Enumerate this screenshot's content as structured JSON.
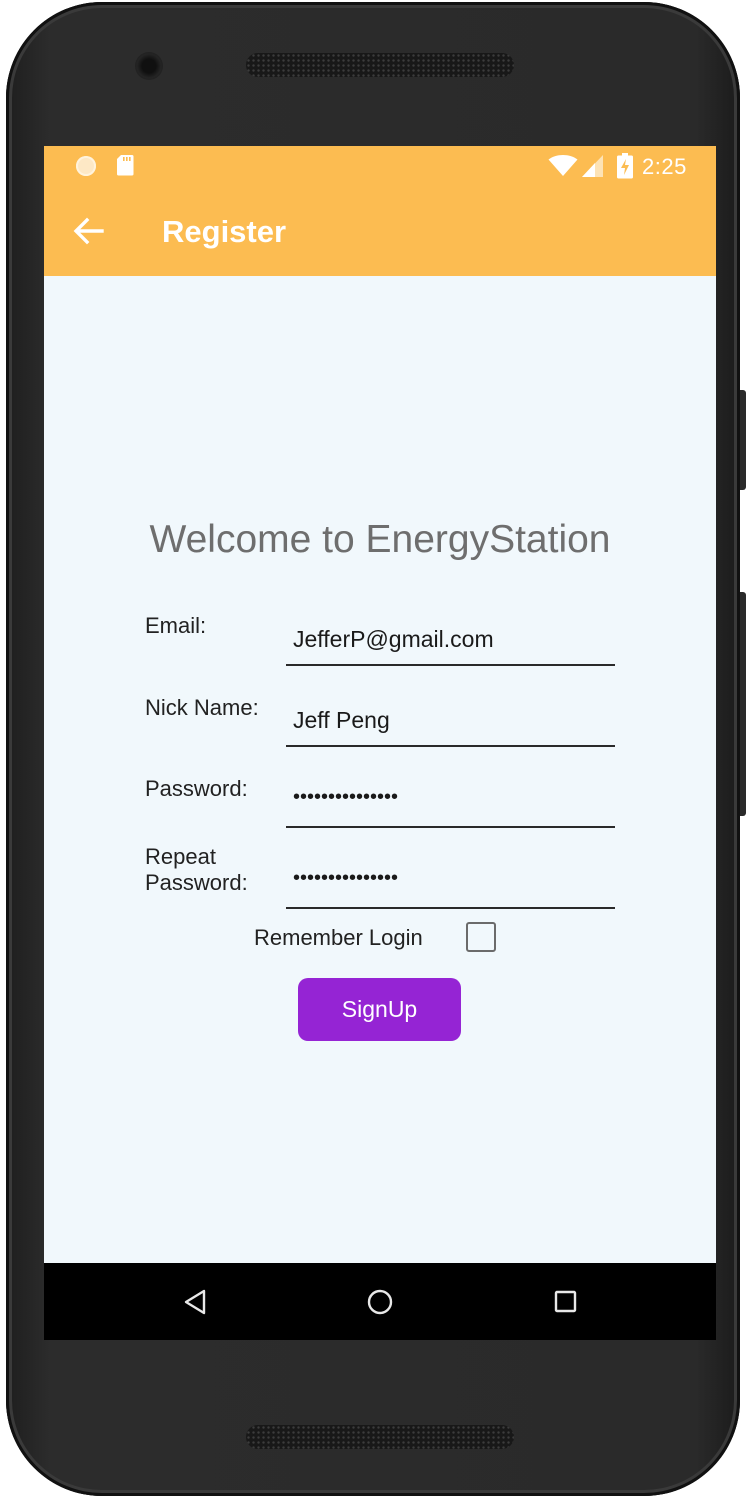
{
  "status_bar": {
    "time": "2:25",
    "icons": [
      "notification-dot-icon",
      "sd-card-icon",
      "wifi-icon",
      "cell-signal-icon",
      "battery-charging-icon"
    ]
  },
  "app_bar": {
    "title": "Register",
    "back_icon": "arrow-back-icon",
    "color": "#fcbc51"
  },
  "main": {
    "welcome": "Welcome to EnergyStation",
    "fields": [
      {
        "label": "Email:",
        "value": "JefferP@gmail.com"
      },
      {
        "label": "Nick Name:",
        "value": "Jeff Peng"
      },
      {
        "label": "Password:",
        "value": "•••••••••••••••"
      },
      {
        "label_line1": "Repeat",
        "label_line2": "Password:",
        "value": "•••••••••••••••"
      }
    ],
    "remember_label": "Remember Login",
    "remember_checked": false,
    "signup_label": "SignUp",
    "signup_color": "#9524d4",
    "background": "#f1f8fc"
  },
  "nav_bar": {
    "icons": [
      "back-triangle-icon",
      "home-circle-icon",
      "recents-square-icon"
    ]
  }
}
